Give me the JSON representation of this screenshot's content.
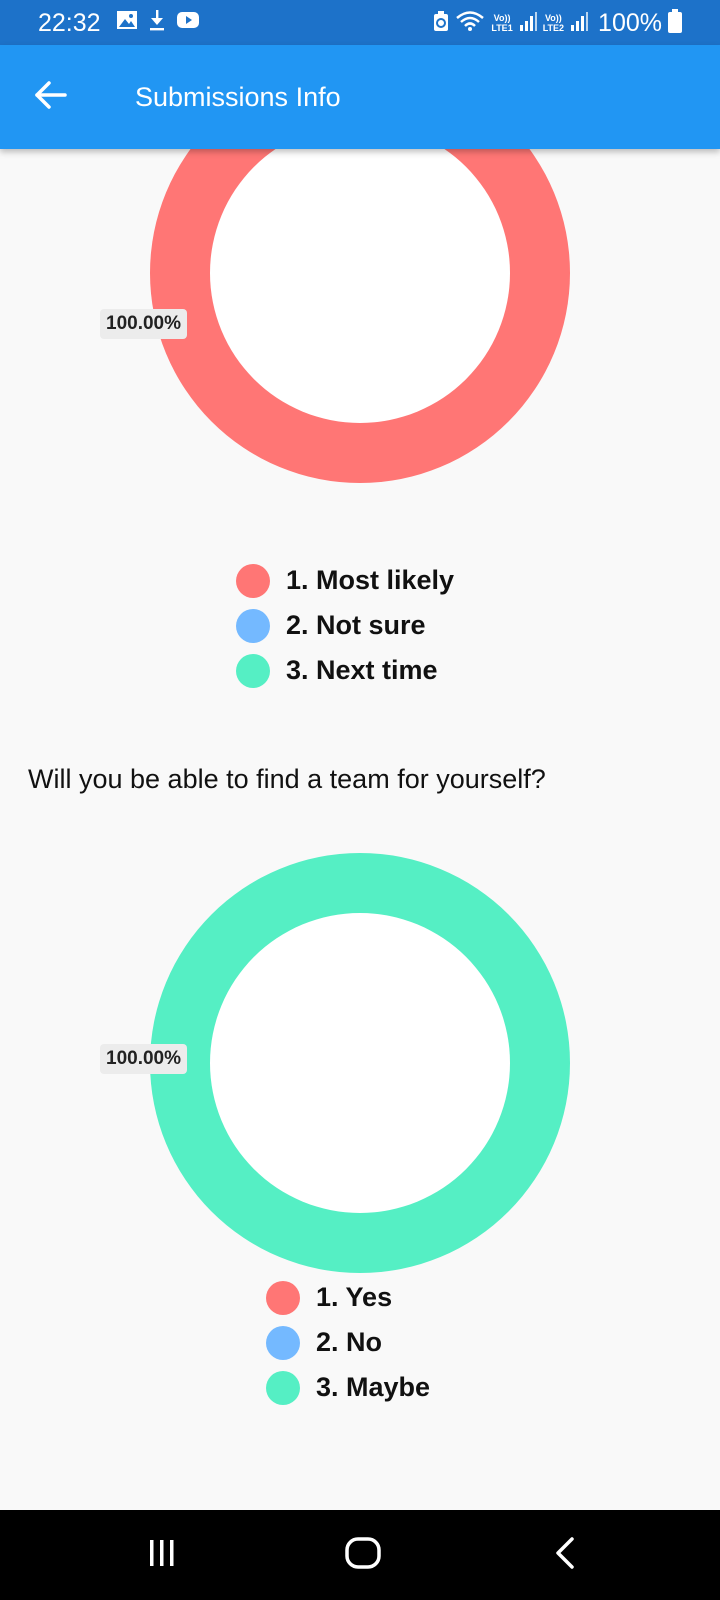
{
  "status_bar": {
    "time": "22:32",
    "battery": "100%",
    "lte1": {
      "top": "Vo))",
      "bottom": "LTE1"
    },
    "lte2": {
      "top": "Vo))",
      "bottom": "LTE2"
    },
    "icons": [
      "gallery-icon",
      "download-icon",
      "youtube-icon",
      "battery-saver-icon",
      "wifi-icon",
      "signal-icon",
      "signal-icon",
      "battery-icon"
    ]
  },
  "app_bar": {
    "title": "Submissions Info",
    "back_icon": "arrow-left-icon"
  },
  "colors": {
    "status_bar": "#1d72c9",
    "app_bar": "#2196f3",
    "option_1": "#ff7675",
    "option_2": "#74b9ff",
    "option_3": "#55efc4"
  },
  "charts": [
    {
      "percent_label": "100.00%",
      "legend": [
        {
          "label": "1. Most likely"
        },
        {
          "label": "2. Not sure"
        },
        {
          "label": "3. Next time"
        }
      ]
    },
    {
      "question": "Will you be able to find a team for yourself?",
      "percent_label": "100.00%",
      "legend": [
        {
          "label": "1. Yes"
        },
        {
          "label": "2. No"
        },
        {
          "label": "3. Maybe"
        }
      ]
    }
  ],
  "chart_data": [
    {
      "type": "pie",
      "categories": [
        "1. Most likely",
        "2. Not sure",
        "3. Next time"
      ],
      "values": [
        100,
        0,
        0
      ],
      "data_labels": [
        "100.00%"
      ],
      "colors": [
        "#ff7675",
        "#74b9ff",
        "#55efc4"
      ],
      "legend_position": "bottom"
    },
    {
      "type": "pie",
      "title": "Will you be able to find a team for yourself?",
      "categories": [
        "1. Yes",
        "2. No",
        "3. Maybe"
      ],
      "values": [
        0,
        0,
        100
      ],
      "data_labels": [
        "100.00%"
      ],
      "colors": [
        "#ff7675",
        "#74b9ff",
        "#55efc4"
      ],
      "legend_position": "bottom"
    }
  ],
  "nav_bar": {
    "icons": [
      "recent-apps-icon",
      "home-icon",
      "back-icon"
    ]
  }
}
